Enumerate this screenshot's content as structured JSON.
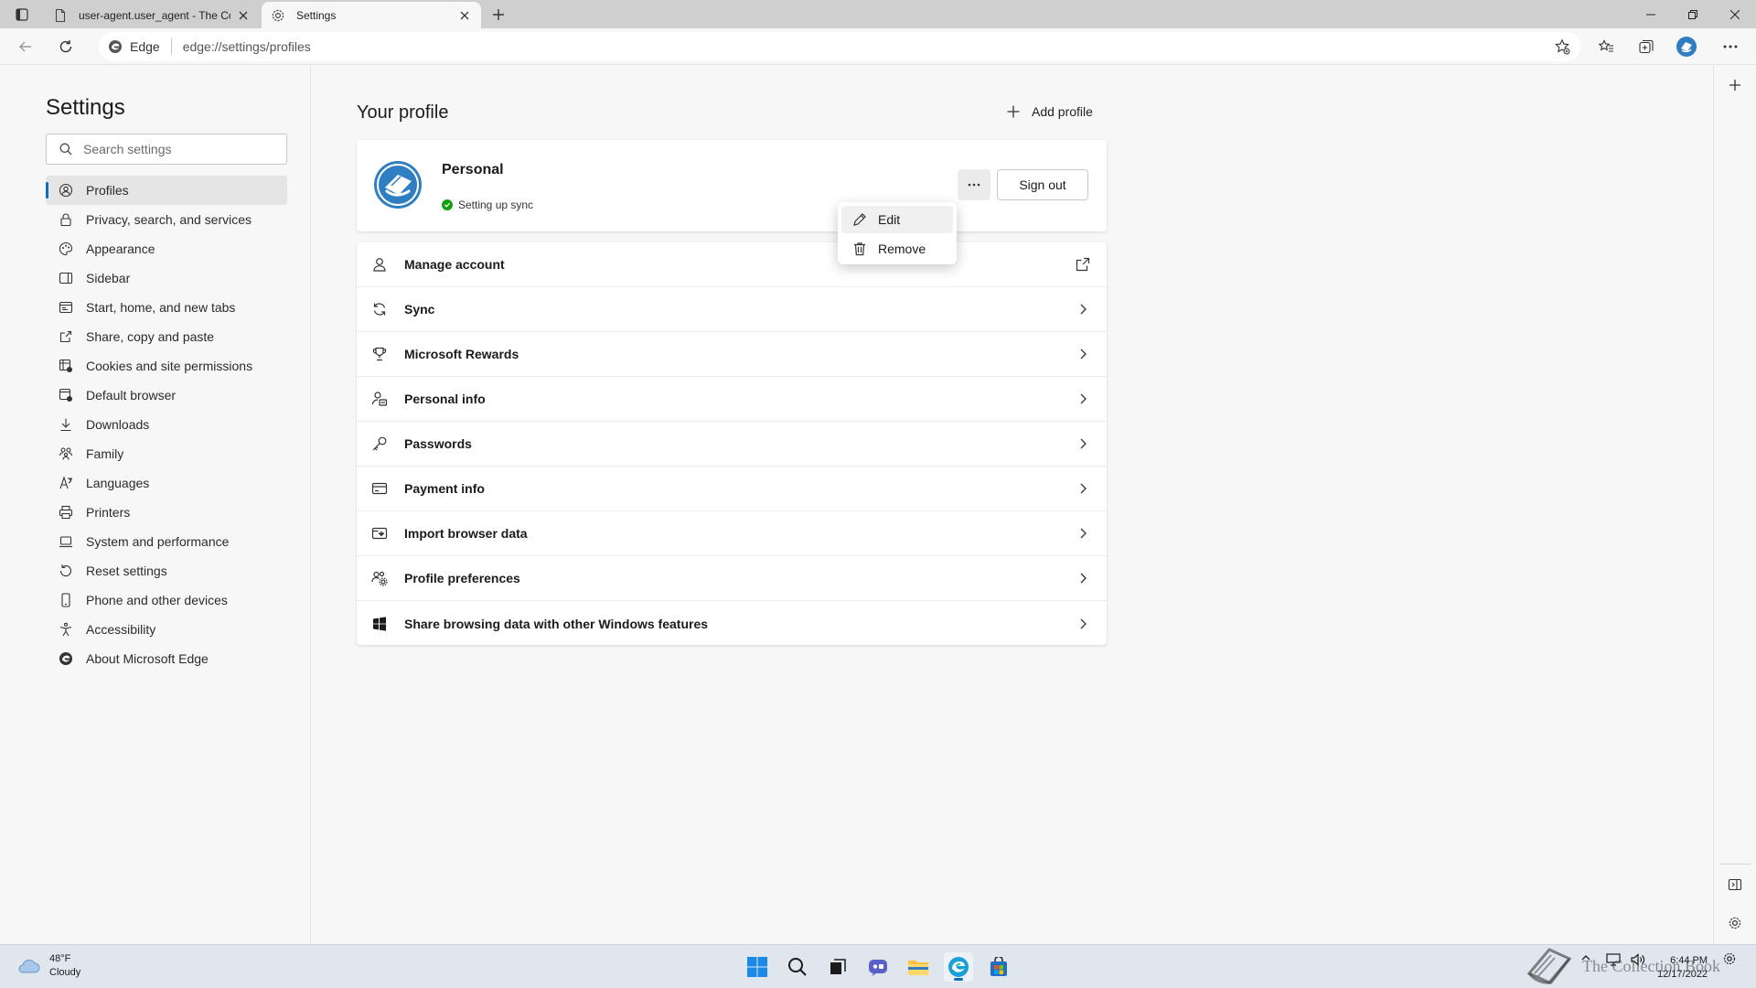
{
  "tabs": [
    {
      "label": "user-agent.user_agent - The Coll",
      "active": false
    },
    {
      "label": "Settings",
      "active": true
    }
  ],
  "address": {
    "site_label": "Edge",
    "url": "edge://settings/profiles"
  },
  "sidebar": {
    "title": "Settings",
    "search_placeholder": "Search settings",
    "items": [
      {
        "label": "Profiles",
        "icon": "profile-icon",
        "active": true
      },
      {
        "label": "Privacy, search, and services",
        "icon": "lock-icon"
      },
      {
        "label": "Appearance",
        "icon": "palette-icon"
      },
      {
        "label": "Sidebar",
        "icon": "sidebar-icon"
      },
      {
        "label": "Start, home, and new tabs",
        "icon": "home-icon"
      },
      {
        "label": "Share, copy and paste",
        "icon": "share-icon"
      },
      {
        "label": "Cookies and site permissions",
        "icon": "cookie-icon"
      },
      {
        "label": "Default browser",
        "icon": "browser-icon"
      },
      {
        "label": "Downloads",
        "icon": "download-icon"
      },
      {
        "label": "Family",
        "icon": "family-icon"
      },
      {
        "label": "Languages",
        "icon": "language-icon"
      },
      {
        "label": "Printers",
        "icon": "printer-icon"
      },
      {
        "label": "System and performance",
        "icon": "laptop-icon"
      },
      {
        "label": "Reset settings",
        "icon": "reset-icon"
      },
      {
        "label": "Phone and other devices",
        "icon": "phone-icon"
      },
      {
        "label": "Accessibility",
        "icon": "accessibility-icon"
      },
      {
        "label": "About Microsoft Edge",
        "icon": "edge-logo-icon"
      }
    ]
  },
  "main": {
    "title": "Your profile",
    "add_profile_label": "Add profile",
    "profile": {
      "name": "Personal",
      "status": "Setting up sync",
      "sign_out_label": "Sign out",
      "more_label": "···"
    },
    "context_menu": {
      "items": [
        {
          "label": "Edit",
          "icon": "pencil-icon"
        },
        {
          "label": "Remove",
          "icon": "trash-icon"
        }
      ]
    },
    "rows": [
      {
        "label": "Manage account",
        "icon": "person-icon",
        "trailing": "external-link-icon"
      },
      {
        "label": "Sync",
        "icon": "sync-icon",
        "trailing": "chevron-right-icon"
      },
      {
        "label": "Microsoft Rewards",
        "icon": "trophy-icon",
        "trailing": "chevron-right-icon"
      },
      {
        "label": "Personal info",
        "icon": "person-card-icon",
        "trailing": "chevron-right-icon"
      },
      {
        "label": "Passwords",
        "icon": "key-icon",
        "trailing": "chevron-right-icon"
      },
      {
        "label": "Payment info",
        "icon": "credit-card-icon",
        "trailing": "chevron-right-icon"
      },
      {
        "label": "Import browser data",
        "icon": "import-icon",
        "trailing": "chevron-right-icon"
      },
      {
        "label": "Profile preferences",
        "icon": "people-settings-icon",
        "trailing": "chevron-right-icon"
      },
      {
        "label": "Share browsing data with other Windows features",
        "icon": "windows-logo-icon",
        "trailing": "chevron-right-icon"
      }
    ]
  },
  "taskbar": {
    "weather_temp": "48°F",
    "weather_desc": "Cloudy",
    "time": "6:44 PM",
    "date": "12/17/2022",
    "watermark": "The Collection Book"
  },
  "colors": {
    "accent": "#0f6cbd",
    "sync_ok": "#13a10e"
  }
}
